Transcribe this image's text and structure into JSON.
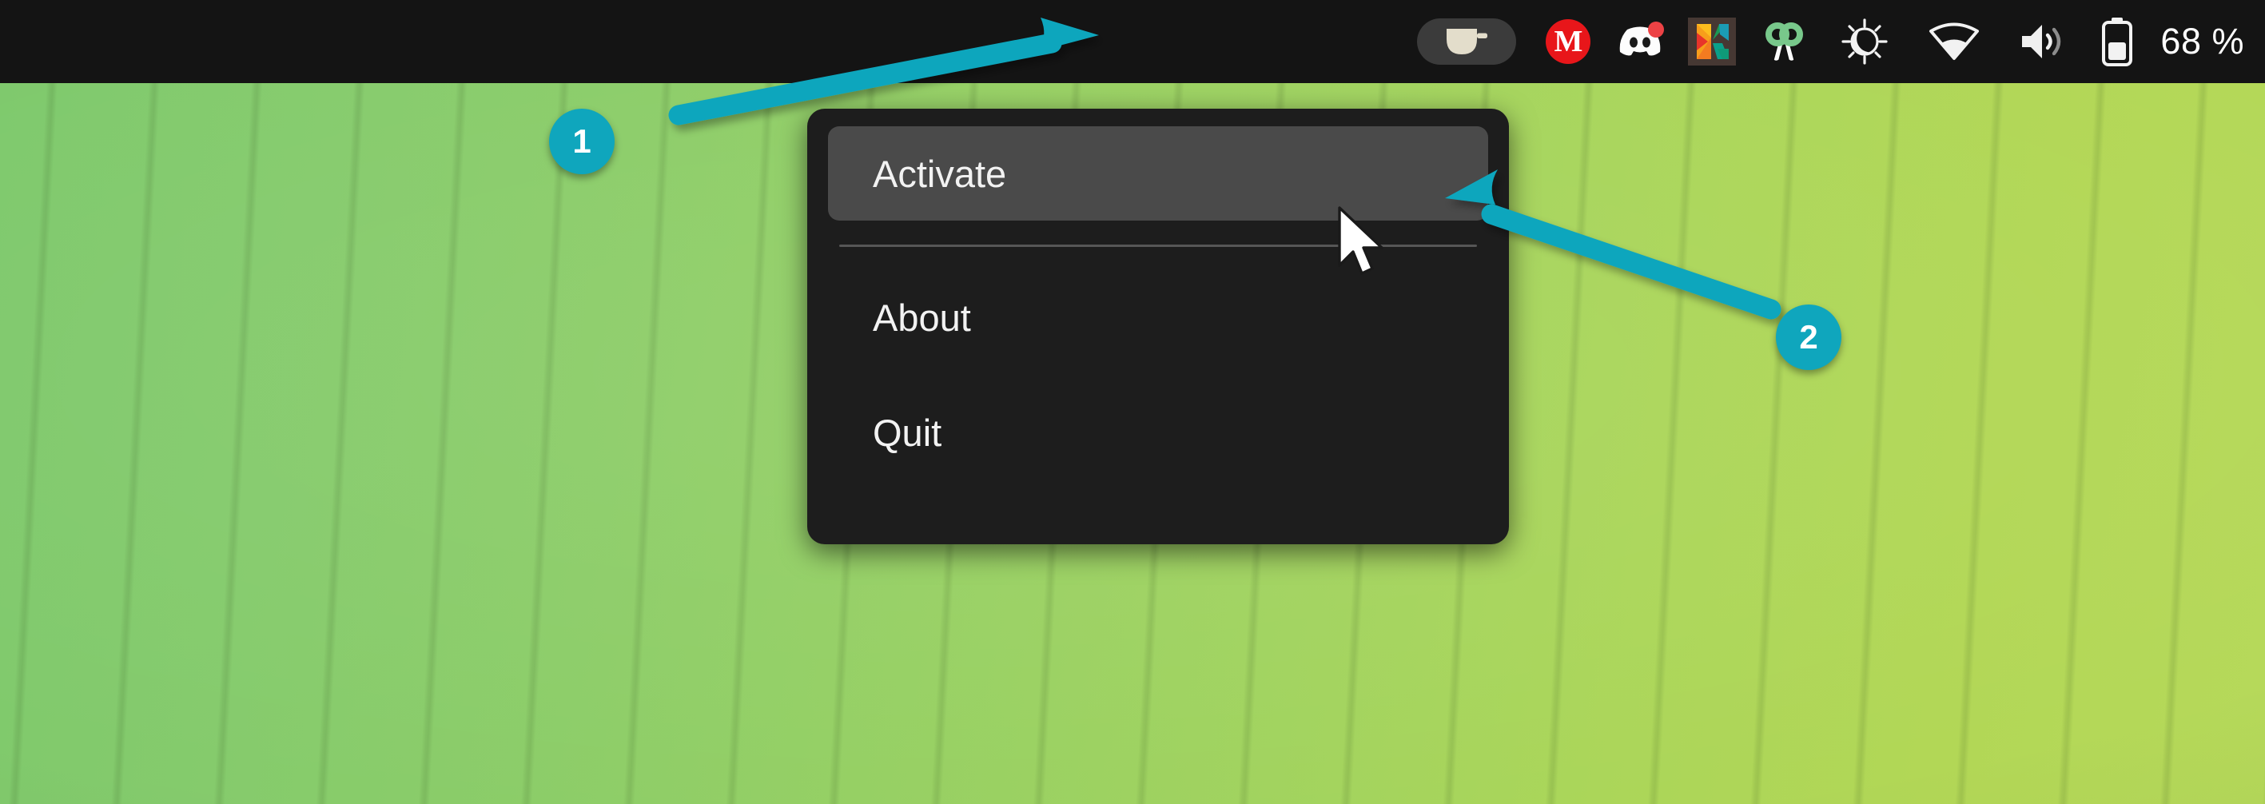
{
  "desktop": {
    "wallpaper_name": "green-grass-blades-wallpaper",
    "wallpaper_colors": {
      "left": "#7ec96c",
      "right": "#b6d95a"
    }
  },
  "topbar": {
    "background_color": "#141414",
    "tray_items": [
      {
        "name": "caffeine-indicator",
        "icon": "coffee-cup-icon",
        "label": "Caffeine",
        "state": "active",
        "pill_color": "#3b3b3b",
        "cup_color": "#e3ddcb"
      },
      {
        "name": "mailspring-indicator",
        "icon": "red-m-circle-icon",
        "label": "M",
        "color": "#e8161a"
      },
      {
        "name": "discord-indicator",
        "icon": "discord-icon",
        "label": "Discord",
        "badge": "notification-dot",
        "badge_color": "#ed4245"
      },
      {
        "name": "kdenlive-indicator",
        "icon": "kdenlive-k-icon",
        "label": "Kdenlive"
      },
      {
        "name": "flameshot-indicator",
        "icon": "scissors-icon",
        "label": "Flameshot",
        "handle_color": "#78c88b"
      },
      {
        "name": "night-light-indicator",
        "icon": "sun-moon-icon",
        "label": "Night Light"
      },
      {
        "name": "network-indicator",
        "icon": "wifi-icon",
        "label": "Wi-Fi"
      },
      {
        "name": "volume-indicator",
        "icon": "speaker-volume-icon",
        "label": "Volume"
      },
      {
        "name": "battery-indicator",
        "icon": "battery-icon",
        "label": "Battery"
      }
    ],
    "battery_percent_text": "68 %"
  },
  "context_menu": {
    "background_color": "#1d1d1d",
    "selected_color": "#4a4a4a",
    "items": [
      {
        "label": "Activate",
        "selected": true
      },
      {
        "label": "About",
        "selected": false
      },
      {
        "label": "Quit",
        "selected": false
      }
    ]
  },
  "annotations": {
    "accent_color": "#0fa6bd",
    "badges": [
      {
        "number": "1"
      },
      {
        "number": "2"
      }
    ],
    "arrows": [
      {
        "name": "arrow-to-caffeine-icon",
        "points_to": "caffeine-indicator"
      },
      {
        "name": "arrow-to-activate-item",
        "points_to": "menu-item-activate"
      }
    ]
  },
  "cursor": {
    "type": "default-arrow-pointer"
  }
}
